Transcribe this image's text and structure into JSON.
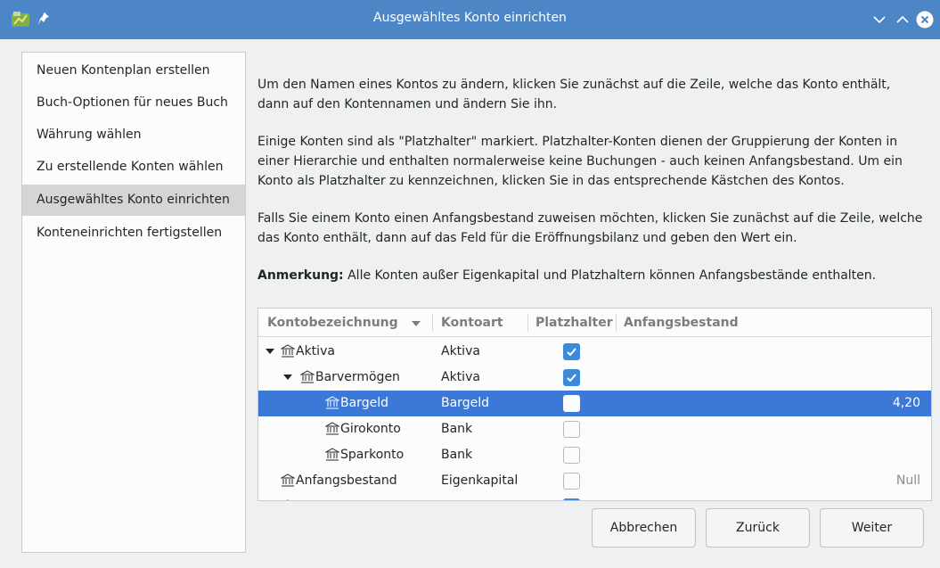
{
  "window": {
    "title": "Ausgewähltes Konto einrichten",
    "colors": {
      "titlebar": "#4d86c7",
      "selection": "#3c78d8",
      "checkbox_checked": "#3c8ad8"
    }
  },
  "sidebar": {
    "items": [
      {
        "label": "Neuen Kontenplan erstellen",
        "active": false
      },
      {
        "label": "Buch-Optionen für neues Buch",
        "active": false
      },
      {
        "label": "Währung wählen",
        "active": false
      },
      {
        "label": "Zu erstellende Konten wählen",
        "active": false
      },
      {
        "label": "Ausgewähltes Konto einrichten",
        "active": true
      },
      {
        "label": "Konteneinrichten fertigstellen",
        "active": false
      }
    ]
  },
  "content": {
    "para1": "Um den Namen eines Kontos zu ändern, klicken Sie zunächst auf die Zeile, welche das Konto enthält, dann auf den Kontennamen und ändern Sie ihn.",
    "para2": "Einige Konten sind als \"Platzhalter\" markiert. Platzhalter-Konten dienen der Gruppierung der Konten in einer Hierarchie und enthalten normalerweise keine Buchungen - auch keinen Anfangsbestand. Um ein Konto als Platzhalter zu kennzeichnen, klicken Sie in das entsprechende Kästchen des Kontos.",
    "para3": "Falls Sie einem Konto einen Anfangsbestand zuweisen möchten, klicken Sie zunächst auf die Zeile, welche das Konto enthält, dann auf das Feld für die Eröffnungsbilanz und geben den Wert ein.",
    "note_label": "Anmerkung:",
    "note_text": " Alle Konten außer Eigenkapital und Platzhaltern können Anfangsbestände enthalten."
  },
  "table": {
    "columns": [
      "Kontobezeichnung",
      "Kontoart",
      "Platzhalter",
      "Anfangsbestand"
    ],
    "rows": [
      {
        "name": "Aktiva",
        "type": "Aktiva",
        "placeholder": true,
        "amount": ""
      },
      {
        "name": "Barvermögen",
        "type": "Aktiva",
        "placeholder": true,
        "amount": ""
      },
      {
        "name": "Bargeld",
        "type": "Bargeld",
        "placeholder": false,
        "amount": "4,20",
        "selected": true
      },
      {
        "name": "Girokonto",
        "type": "Bank",
        "placeholder": false,
        "amount": ""
      },
      {
        "name": "Sparkonto",
        "type": "Bank",
        "placeholder": false,
        "amount": ""
      },
      {
        "name": "Anfangsbestand",
        "type": "Eigenkapital",
        "placeholder": false,
        "amount": "Null"
      }
    ]
  },
  "buttons": {
    "cancel": "Abbrechen",
    "back": "Zurück",
    "next": "Weiter"
  }
}
